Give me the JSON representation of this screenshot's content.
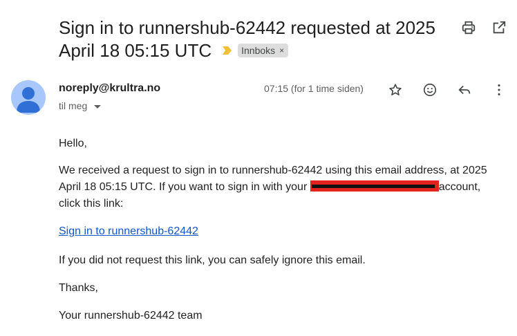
{
  "email": {
    "subject": "Sign in to runnershub-62442 requested at 2025 April 18 05:15 UTC",
    "label": "Innboks",
    "label_remove": "×",
    "importance_icon": "importance-marker-icon",
    "colors": {
      "importance": "#f2c037",
      "avatar": "#a8c7fa",
      "avatar_figure": "#2f6fd6",
      "link": "#1155cc",
      "redaction": "#e3241e"
    }
  },
  "header_actions": {
    "print_icon": "print-icon",
    "open_new_window_icon": "open-in-new-window-icon"
  },
  "message": {
    "sender": "noreply@krultra.no",
    "recipient": "til meg",
    "timestamp": "07:15 (for 1 time siden)",
    "actions": [
      "star-icon",
      "emoji-reaction-icon",
      "reply-icon",
      "more-options-icon"
    ]
  },
  "body": {
    "greeting": "Hello,",
    "request_intro": "We received a request to sign in to runnershub-62442 using this email address, at 2025 April 18 05:15 UTC. If you want to sign in with your",
    "request_after": "account, click this link:",
    "link_text": "Sign in to runnershub-62442",
    "ignore_text": "If you did not request this link, you can safely ignore this email.",
    "thanks": "Thanks,",
    "team": "Your runnershub-62442 team"
  }
}
